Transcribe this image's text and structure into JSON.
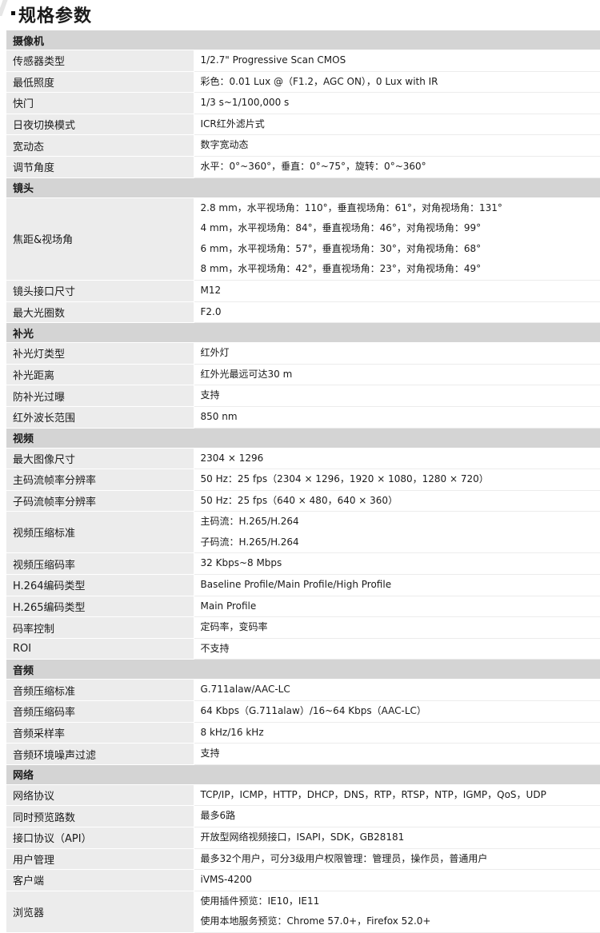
{
  "title": "规格参数",
  "sections": [
    {
      "name": "摄像机",
      "rows": [
        {
          "label": "传感器类型",
          "values": [
            "1/2.7\" Progressive Scan CMOS"
          ]
        },
        {
          "label": "最低照度",
          "values": [
            "彩色：0.01 Lux @（F1.2，AGC ON），0 Lux with IR"
          ]
        },
        {
          "label": "快门",
          "values": [
            "1/3 s~1/100,000 s"
          ]
        },
        {
          "label": "日夜切换模式",
          "values": [
            "ICR红外滤片式"
          ]
        },
        {
          "label": "宽动态",
          "values": [
            "数字宽动态"
          ]
        },
        {
          "label": "调节角度",
          "values": [
            "水平：0°~360°，垂直：0°~75°，旋转：0°~360°"
          ]
        }
      ]
    },
    {
      "name": "镜头",
      "rows": [
        {
          "label": "焦距&视场角",
          "values": [
            "2.8 mm，水平视场角：110°，垂直视场角：61°，对角视场角：131°",
            "4 mm，水平视场角：84°，垂直视场角：46°，对角视场角：99°",
            "6 mm，水平视场角：57°，垂直视场角：30°，对角视场角：68°",
            "8 mm，水平视场角：42°，垂直视场角：23°，对角视场角：49°"
          ]
        },
        {
          "label": "镜头接口尺寸",
          "values": [
            "M12"
          ]
        },
        {
          "label": "最大光圈数",
          "values": [
            "F2.0"
          ]
        }
      ]
    },
    {
      "name": "补光",
      "rows": [
        {
          "label": "补光灯类型",
          "values": [
            "红外灯"
          ]
        },
        {
          "label": "补光距离",
          "values": [
            "红外光最远可达30 m"
          ]
        },
        {
          "label": "防补光过曝",
          "values": [
            "支持"
          ]
        },
        {
          "label": "红外波长范围",
          "values": [
            "850 nm"
          ]
        }
      ]
    },
    {
      "name": "视频",
      "rows": [
        {
          "label": "最大图像尺寸",
          "values": [
            "2304 × 1296"
          ]
        },
        {
          "label": "主码流帧率分辨率",
          "values": [
            "50 Hz：25 fps（2304 × 1296，1920 × 1080，1280 × 720）"
          ]
        },
        {
          "label": "子码流帧率分辨率",
          "values": [
            "50 Hz：25 fps（640 × 480，640 × 360）"
          ]
        },
        {
          "label": "视频压缩标准",
          "values": [
            "主码流：H.265/H.264",
            "子码流：H.265/H.264"
          ]
        },
        {
          "label": "视频压缩码率",
          "values": [
            "32 Kbps~8 Mbps"
          ]
        },
        {
          "label": "H.264编码类型",
          "values": [
            "Baseline Profile/Main Profile/High Profile"
          ]
        },
        {
          "label": "H.265编码类型",
          "values": [
            "Main Profile"
          ]
        },
        {
          "label": "码率控制",
          "values": [
            "定码率，变码率"
          ]
        },
        {
          "label": "ROI",
          "values": [
            "不支持"
          ]
        }
      ]
    },
    {
      "name": "音频",
      "rows": [
        {
          "label": "音频压缩标准",
          "values": [
            "G.711alaw/AAC-LC"
          ]
        },
        {
          "label": "音频压缩码率",
          "values": [
            "64 Kbps（G.711alaw）/16~64 Kbps（AAC-LC）"
          ]
        },
        {
          "label": "音频采样率",
          "values": [
            "8 kHz/16 kHz"
          ]
        },
        {
          "label": "音频环境噪声过滤",
          "values": [
            "支持"
          ]
        }
      ]
    },
    {
      "name": "网络",
      "rows": [
        {
          "label": "网络协议",
          "values": [
            "TCP/IP，ICMP，HTTP，DHCP，DNS，RTP，RTSP，NTP，IGMP，QoS，UDP"
          ]
        },
        {
          "label": "同时预览路数",
          "values": [
            "最多6路"
          ]
        },
        {
          "label": "接口协议（API）",
          "values": [
            "开放型网络视频接口，ISAPI，SDK，GB28181"
          ]
        },
        {
          "label": "用户管理",
          "values": [
            "最多32个用户，可分3级用户权限管理：管理员，操作员，普通用户"
          ]
        },
        {
          "label": "客户端",
          "values": [
            "iVMS-4200"
          ]
        },
        {
          "label": "浏览器",
          "values": [
            "使用插件预览：IE10，IE11",
            "使用本地服务预览：Chrome 57.0+，Firefox 52.0+"
          ]
        }
      ]
    }
  ]
}
